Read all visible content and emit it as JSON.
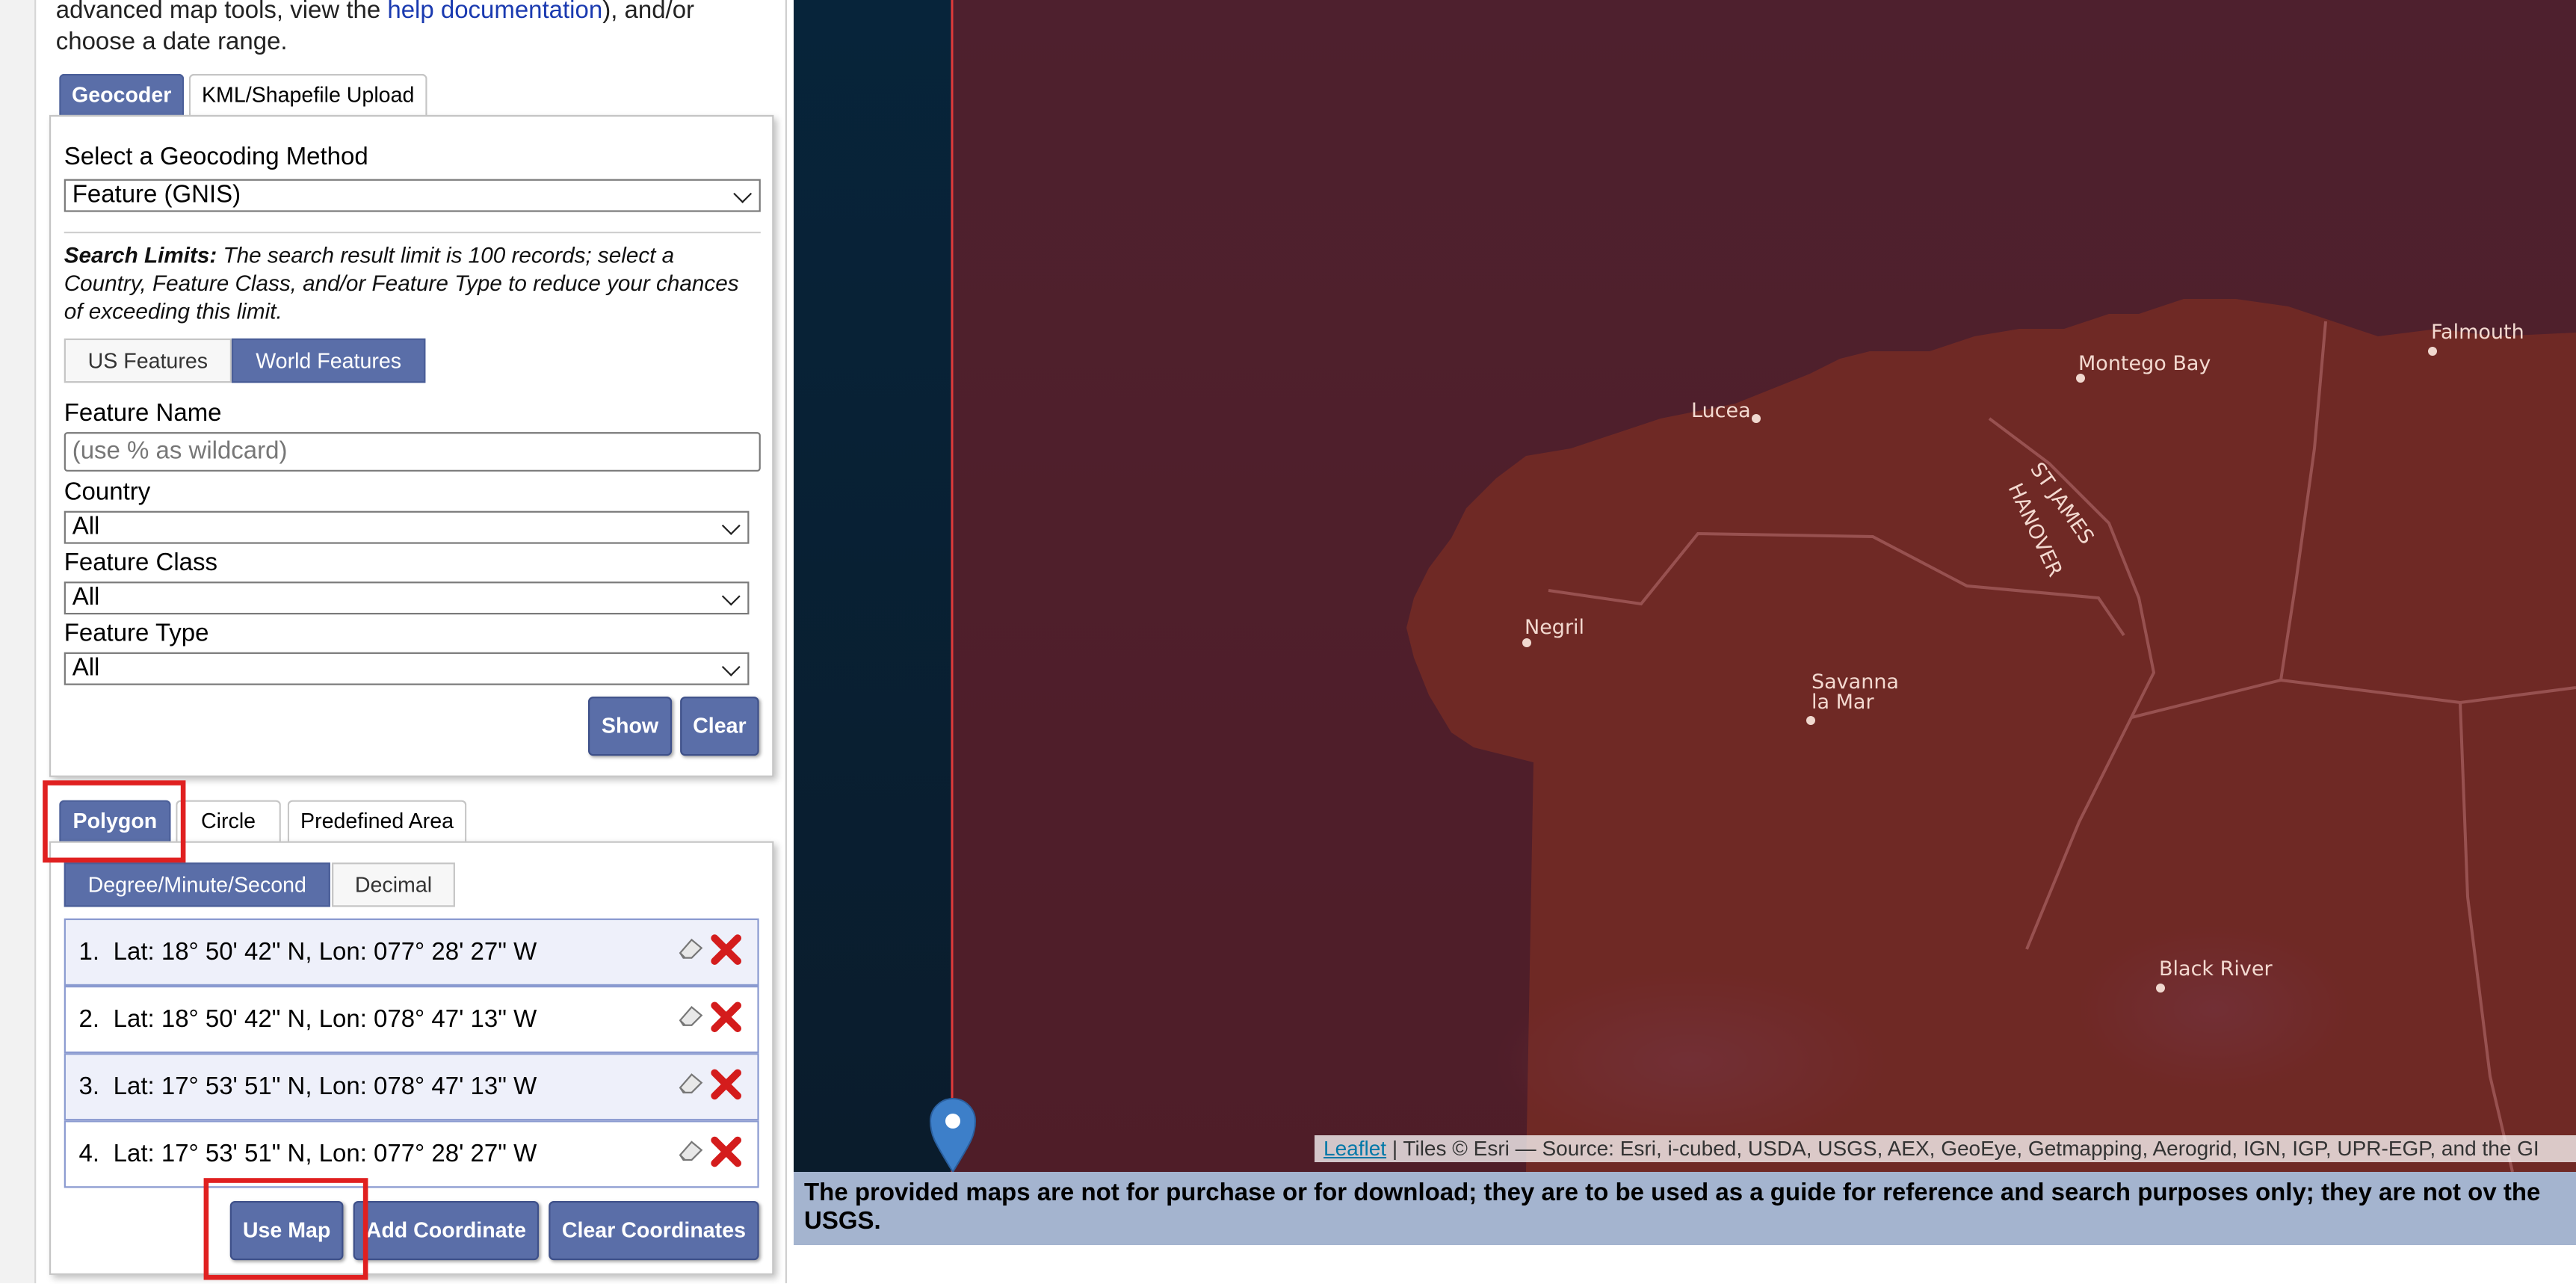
{
  "intro": {
    "line1_prefix": "advanced map tools, view the ",
    "line1_link": "help documentation",
    "line1_suffix": "), and/or",
    "line2": "choose a date range."
  },
  "geocoder_tabs": [
    "Geocoder",
    "KML/Shapefile Upload"
  ],
  "geocoder": {
    "method_label": "Select a Geocoding Method",
    "method_value": "Feature (GNIS)",
    "limits_bold": "Search Limits:",
    "limits_text": " The search result limit is 100 records; select a Country, Feature Class, and/or Feature Type to reduce your chances of exceeding this limit.",
    "feature_scope": [
      "US Features",
      "World Features"
    ],
    "feature_name_label": "Feature Name",
    "feature_name_placeholder": "(use % as wildcard)",
    "country_label": "Country",
    "country_value": "All",
    "class_label": "Feature Class",
    "class_value": "All",
    "type_label": "Feature Type",
    "type_value": "All",
    "show_button": "Show",
    "clear_button": "Clear"
  },
  "area_tabs": [
    "Polygon",
    "Circle",
    "Predefined Area"
  ],
  "format_toggle": [
    "Degree/Minute/Second",
    "Decimal"
  ],
  "coordinates": [
    {
      "num": "1.",
      "text": "Lat: 18° 50' 42\" N, Lon: 077° 28' 27\" W"
    },
    {
      "num": "2.",
      "text": "Lat: 18° 50' 42\" N, Lon: 078° 47' 13\" W"
    },
    {
      "num": "3.",
      "text": "Lat: 17° 53' 51\" N, Lon: 078° 47' 13\" W"
    },
    {
      "num": "4.",
      "text": "Lat: 17° 53' 51\" N, Lon: 077° 28' 27\" W"
    }
  ],
  "coord_buttons": {
    "use_map": "Use Map",
    "add_coordinate": "Add Coordinate",
    "clear_coordinates": "Clear Coordinates"
  },
  "map": {
    "places": [
      "Montego Bay",
      "Falmouth",
      "Lucea",
      "ST JAMES",
      "HANOVER",
      "Negril",
      "Savanna",
      "la Mar",
      "Black River"
    ],
    "attribution_link": "Leaflet",
    "attribution_text": " | Tiles © Esri — Source: Esri, i-cubed, USDA, USGS, AEX, GeoEye, Getmapping, Aerogrid, IGN, IGP, UPR-EGP, and the GI"
  },
  "notice": "The provided maps are not for purchase or for download; they are to be used as a guide for reference and search purposes only; they are not ov the USGS.",
  "colors": {
    "accent": "#5a6ea8",
    "highlight": "#e02020",
    "polygon_fill": "#7a1e26",
    "marker": "#3d7fc9",
    "notice_bg": "#a4b4cf"
  }
}
